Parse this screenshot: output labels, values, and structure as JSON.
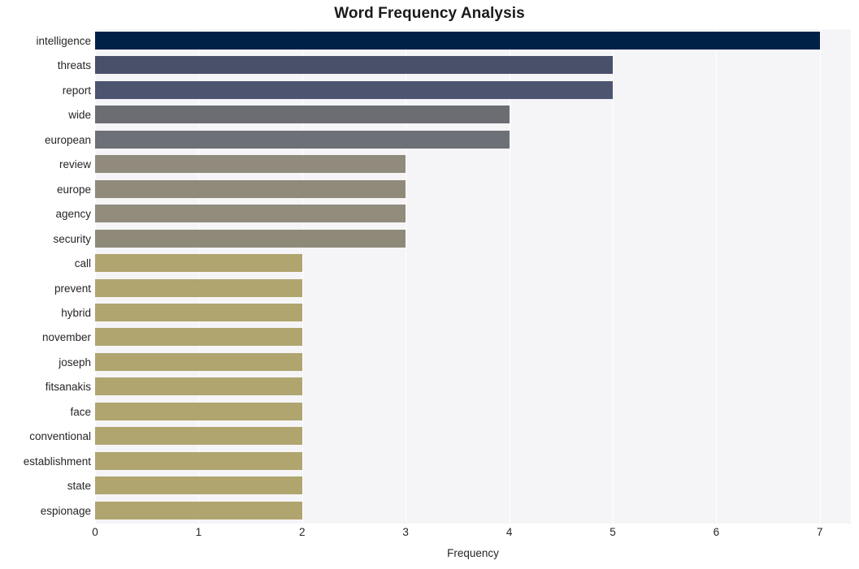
{
  "chart_data": {
    "type": "bar",
    "orientation": "horizontal",
    "title": "Word Frequency Analysis",
    "xlabel": "Frequency",
    "ylabel": "",
    "xlim": [
      0,
      7.3
    ],
    "xticks": [
      "0",
      "1",
      "2",
      "3",
      "4",
      "5",
      "6",
      "7"
    ],
    "xtick_values": [
      0,
      1,
      2,
      3,
      4,
      5,
      6,
      7
    ],
    "grid": true,
    "grid_axis": "x",
    "legend": false,
    "categories": [
      "intelligence",
      "threats",
      "report",
      "wide",
      "european",
      "review",
      "europe",
      "agency",
      "security",
      "call",
      "prevent",
      "hybrid",
      "november",
      "joseph",
      "fitsanakis",
      "face",
      "conventional",
      "establishment",
      "state",
      "espionage"
    ],
    "values": [
      7,
      5,
      5,
      4,
      4,
      3,
      3,
      3,
      3,
      2,
      2,
      2,
      2,
      2,
      2,
      2,
      2,
      2,
      2,
      2
    ],
    "bar_colors": [
      "#002147",
      "#49506a",
      "#4d5470",
      "#6b6d73",
      "#6d7076",
      "#908b7c",
      "#8f8a7a",
      "#918c7c",
      "#8e8979",
      "#b0a56f",
      "#b0a56f",
      "#b0a56f",
      "#b0a56f",
      "#b0a56f",
      "#b0a56f",
      "#b0a56f",
      "#b0a56f",
      "#b0a56f",
      "#b0a56f",
      "#b0a56f"
    ],
    "plot_background": "#f5f5f7",
    "grid_color": "#ffffff",
    "figure_background": "#ffffff"
  }
}
